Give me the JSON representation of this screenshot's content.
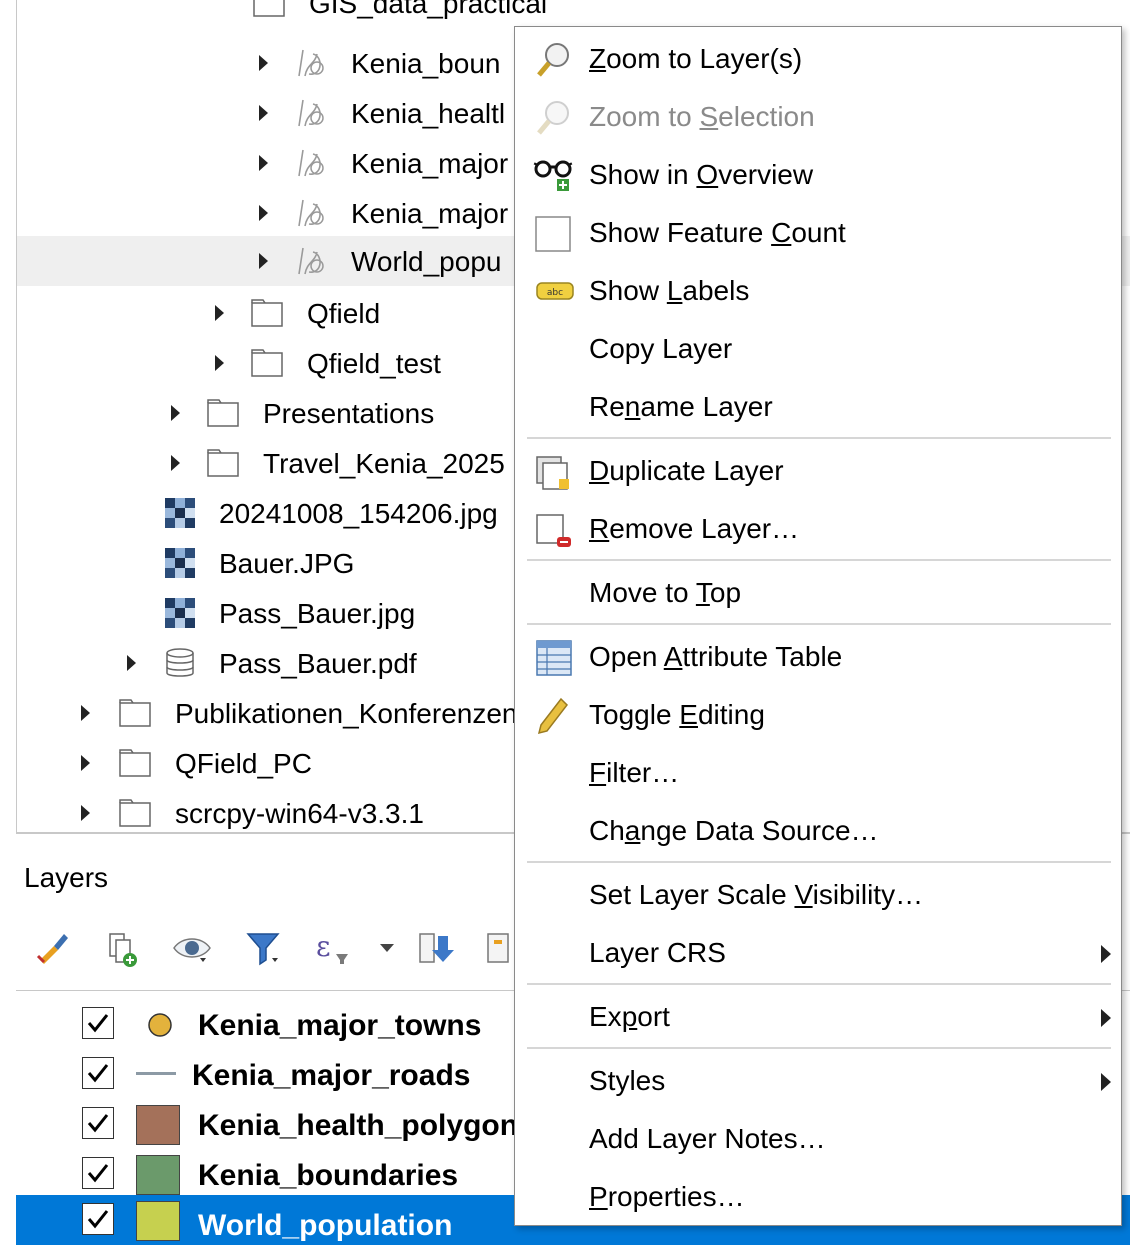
{
  "browser": {
    "items": [
      {
        "label": "GIS_data_practical",
        "kind": "folder"
      },
      {
        "label": "Kenia_boun",
        "kind": "vector"
      },
      {
        "label": "Kenia_healtl",
        "kind": "vector"
      },
      {
        "label": "Kenia_major",
        "kind": "vector"
      },
      {
        "label": "Kenia_major",
        "kind": "vector"
      },
      {
        "label": "World_popu",
        "kind": "vector"
      },
      {
        "label": "Qfield",
        "kind": "folder"
      },
      {
        "label": "Qfield_test",
        "kind": "folder"
      },
      {
        "label": "Presentations",
        "kind": "folder"
      },
      {
        "label": "Travel_Kenia_2025",
        "kind": "folder"
      },
      {
        "label": "20241008_154206.jpg",
        "kind": "raster"
      },
      {
        "label": "Bauer.JPG",
        "kind": "raster"
      },
      {
        "label": "Pass_Bauer.jpg",
        "kind": "raster"
      },
      {
        "label": "Pass_Bauer.pdf",
        "kind": "database"
      },
      {
        "label": "Publikationen_Konferenzen",
        "kind": "folder"
      },
      {
        "label": "QField_PC",
        "kind": "folder"
      },
      {
        "label": "scrcpy-win64-v3.3.1",
        "kind": "folder"
      }
    ]
  },
  "layers": {
    "title": "Layers",
    "toolbar_icons": [
      "style-brush-icon",
      "add-group-icon",
      "eye-visibility-icon",
      "filter-icon",
      "filter-expression-icon",
      "dropdown-arrow-icon",
      "expand-all-icon",
      "collapse-all-icon"
    ],
    "items": [
      {
        "name": "Kenia_major_towns",
        "symbol": "point",
        "color": "#e3b23c",
        "checked": true
      },
      {
        "name": "Kenia_major_roads",
        "symbol": "line",
        "color": "#8c9aa5",
        "checked": true
      },
      {
        "name": "Kenia_health_polygons",
        "symbol": "fill",
        "color": "#a4715a",
        "checked": true
      },
      {
        "name": "Kenia_boundaries",
        "symbol": "fill",
        "color": "#6b9a6b",
        "checked": true
      },
      {
        "name": "World_population",
        "symbol": "fill",
        "color": "#c6d04f",
        "checked": true
      }
    ]
  },
  "context_menu": {
    "zoom_to_layers": {
      "pre": "",
      "key": "Z",
      "post": "oom to Layer(s)"
    },
    "zoom_to_selection": {
      "pre": "Zoom to ",
      "key": "S",
      "post": "election"
    },
    "show_in_overview": {
      "pre": "Show in ",
      "key": "O",
      "post": "verview"
    },
    "show_feature_count": {
      "pre": "Show Feature ",
      "key": "C",
      "post": "ount"
    },
    "show_labels": {
      "pre": "Show ",
      "key": "L",
      "post": "abels"
    },
    "copy_layer": {
      "pre": "Copy Layer",
      "key": "",
      "post": ""
    },
    "rename_layer": {
      "pre": "Re",
      "key": "n",
      "post": "ame Layer"
    },
    "duplicate_layer": {
      "pre": "",
      "key": "D",
      "post": "uplicate Layer"
    },
    "remove_layer": {
      "pre": "",
      "key": "R",
      "post": "emove Layer…"
    },
    "move_to_top": {
      "pre": "Move to ",
      "key": "T",
      "post": "op"
    },
    "open_attribute_table": {
      "pre": "Open ",
      "key": "A",
      "post": "ttribute Table"
    },
    "toggle_editing": {
      "pre": "Toggle ",
      "key": "E",
      "post": "diting"
    },
    "filter": {
      "pre": "",
      "key": "F",
      "post": "ilter…"
    },
    "change_data_source": {
      "pre": "Ch",
      "key": "a",
      "post": "nge Data Source…"
    },
    "set_scale_visibility": {
      "pre": "Set Layer Scale ",
      "key": "V",
      "post": "isibility…"
    },
    "layer_crs": {
      "pre": "Layer CRS",
      "key": "",
      "post": ""
    },
    "export": {
      "pre": "Ex",
      "key": "p",
      "post": "ort"
    },
    "styles": {
      "pre": "Styles",
      "key": "",
      "post": ""
    },
    "add_layer_notes": {
      "pre": "Add Layer Notes…",
      "key": "",
      "post": ""
    },
    "properties": {
      "pre": "",
      "key": "P",
      "post": "roperties…"
    }
  }
}
